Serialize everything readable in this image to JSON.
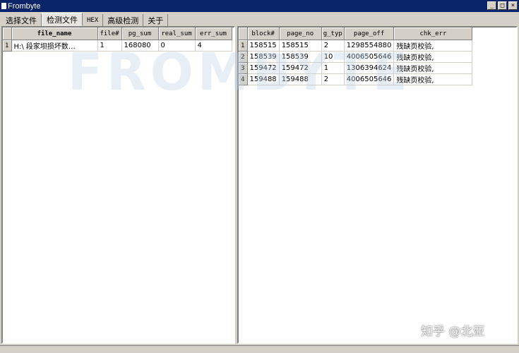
{
  "window": {
    "title": "Frombyte",
    "minimize_glyph": "_",
    "maximize_glyph": "□",
    "close_glyph": "×"
  },
  "menu": {
    "tabs": [
      {
        "label": "选择文件",
        "active": false
      },
      {
        "label": "检测文件",
        "active": true
      },
      {
        "label": "HEX",
        "active": false
      },
      {
        "label": "高级检测",
        "active": false
      },
      {
        "label": "关于",
        "active": false
      }
    ]
  },
  "left_table": {
    "headers": [
      "file_name",
      "file#",
      "pg_sum",
      "real_sum",
      "err_sum"
    ],
    "rows": [
      {
        "num": "1",
        "file_name": "H:\\      段家坝损坏数…",
        "file_no": "1",
        "pg_sum": "168080",
        "real_sum": "0",
        "err_sum": "4"
      }
    ]
  },
  "right_table": {
    "headers": [
      "block#",
      "page_no",
      "g_typ",
      "page_off",
      "chk_err"
    ],
    "rows": [
      {
        "num": "1",
        "block": "158515",
        "page_no": "158515",
        "g_typ": "2",
        "page_off": "1298554880",
        "chk_err": "残缺页校验,"
      },
      {
        "num": "2",
        "block": "158539",
        "page_no": "158539",
        "g_typ": "10",
        "page_off": "4006505646",
        "chk_err": "残缺页校验,"
      },
      {
        "num": "3",
        "block": "159472",
        "page_no": "159472",
        "g_typ": "1",
        "page_off": "1306394624",
        "chk_err": "残缺页校验,"
      },
      {
        "num": "4",
        "block": "159488",
        "page_no": "159488",
        "g_typ": "2",
        "page_off": "4006505646",
        "chk_err": "残缺页校验,"
      }
    ]
  },
  "watermark": {
    "logo_text": "FROMBYTE",
    "credit": "知乎 @北亚"
  }
}
